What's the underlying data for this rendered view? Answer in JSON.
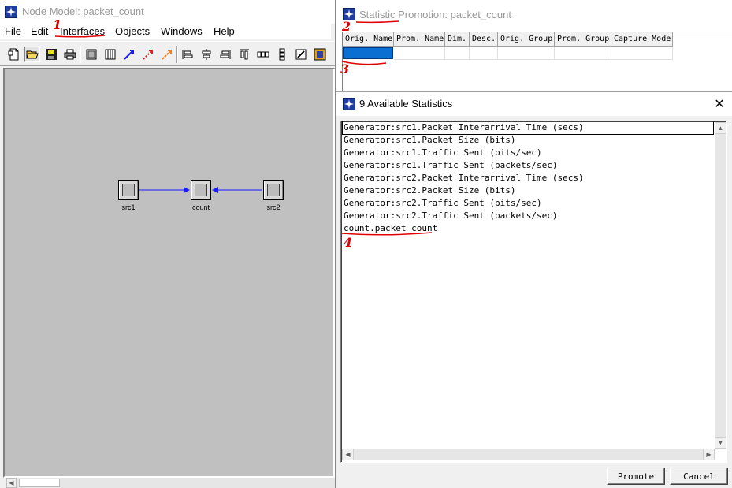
{
  "main": {
    "title": "Node Model: packet_count",
    "menu": [
      "File",
      "Edit",
      "Interfaces",
      "Objects",
      "Windows",
      "Help"
    ],
    "nodes": [
      {
        "label": "src1"
      },
      {
        "label": "count"
      },
      {
        "label": "src2"
      }
    ]
  },
  "promotion": {
    "title": "Statistic Promotion: packet_count",
    "columns": [
      "Orig. Name",
      "Prom. Name",
      "Dim.",
      "Desc.",
      "Orig. Group",
      "Prom. Group",
      "Capture Mode"
    ]
  },
  "available": {
    "title": "9 Available Statistics",
    "close_glyph": "✕",
    "items": [
      "Generator:src1.Packet Interarrival Time (secs)",
      "Generator:src1.Packet Size (bits)",
      "Generator:src1.Traffic Sent (bits/sec)",
      "Generator:src1.Traffic Sent (packets/sec)",
      "Generator:src2.Packet Interarrival Time (secs)",
      "Generator:src2.Packet Size (bits)",
      "Generator:src2.Traffic Sent (bits/sec)",
      "Generator:src2.Traffic Sent (packets/sec)",
      "count.packet count"
    ],
    "promote_label": "Promote",
    "cancel_label": "Cancel"
  },
  "annotations": [
    "1",
    "2",
    "3",
    "4"
  ],
  "colors": {
    "link": "#1a1aff",
    "annotation": "#e00000",
    "selection": "#0b6fd1",
    "canvas": "#c0c0c0"
  }
}
